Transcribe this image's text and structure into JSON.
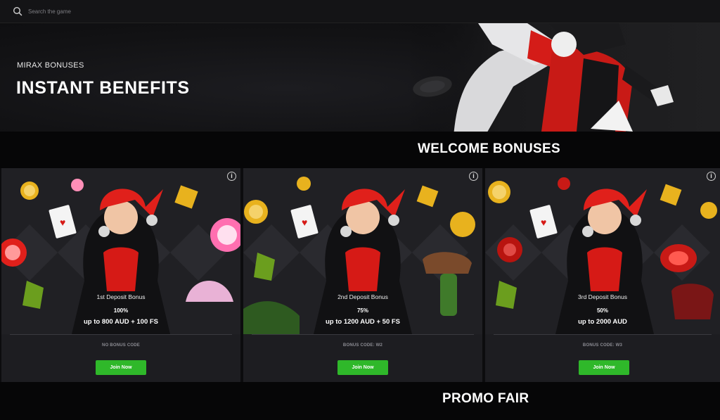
{
  "search": {
    "placeholder": "Search the game",
    "icon": "search-icon"
  },
  "hero": {
    "kicker": "MIRAX BONUSES",
    "title": "INSTANT BENEFITS"
  },
  "welcome": {
    "title": "WELCOME BONUSES"
  },
  "bonuses": [
    {
      "name": "1st Deposit Bonus",
      "percent": "100%",
      "offer": "up to 800 AUD + 100 FS",
      "code": "NO BONUS CODE",
      "button": "Join Now"
    },
    {
      "name": "2nd Deposit Bonus",
      "percent": "75%",
      "offer": "up to 1200 AUD + 50 FS",
      "code": "BONUS CODE: W2",
      "button": "Join Now"
    },
    {
      "name": "3rd Deposit Bonus",
      "percent": "50%",
      "offer": "up to 2000 AUD",
      "code": "BONUS CODE: W3",
      "button": "Join Now"
    }
  ],
  "promo": {
    "title": "PROMO FAIR"
  },
  "colors": {
    "accent_green": "#2fb82a",
    "jester_red": "#e0201b",
    "gold": "#e8b21e",
    "background": "#0c0c0e"
  }
}
